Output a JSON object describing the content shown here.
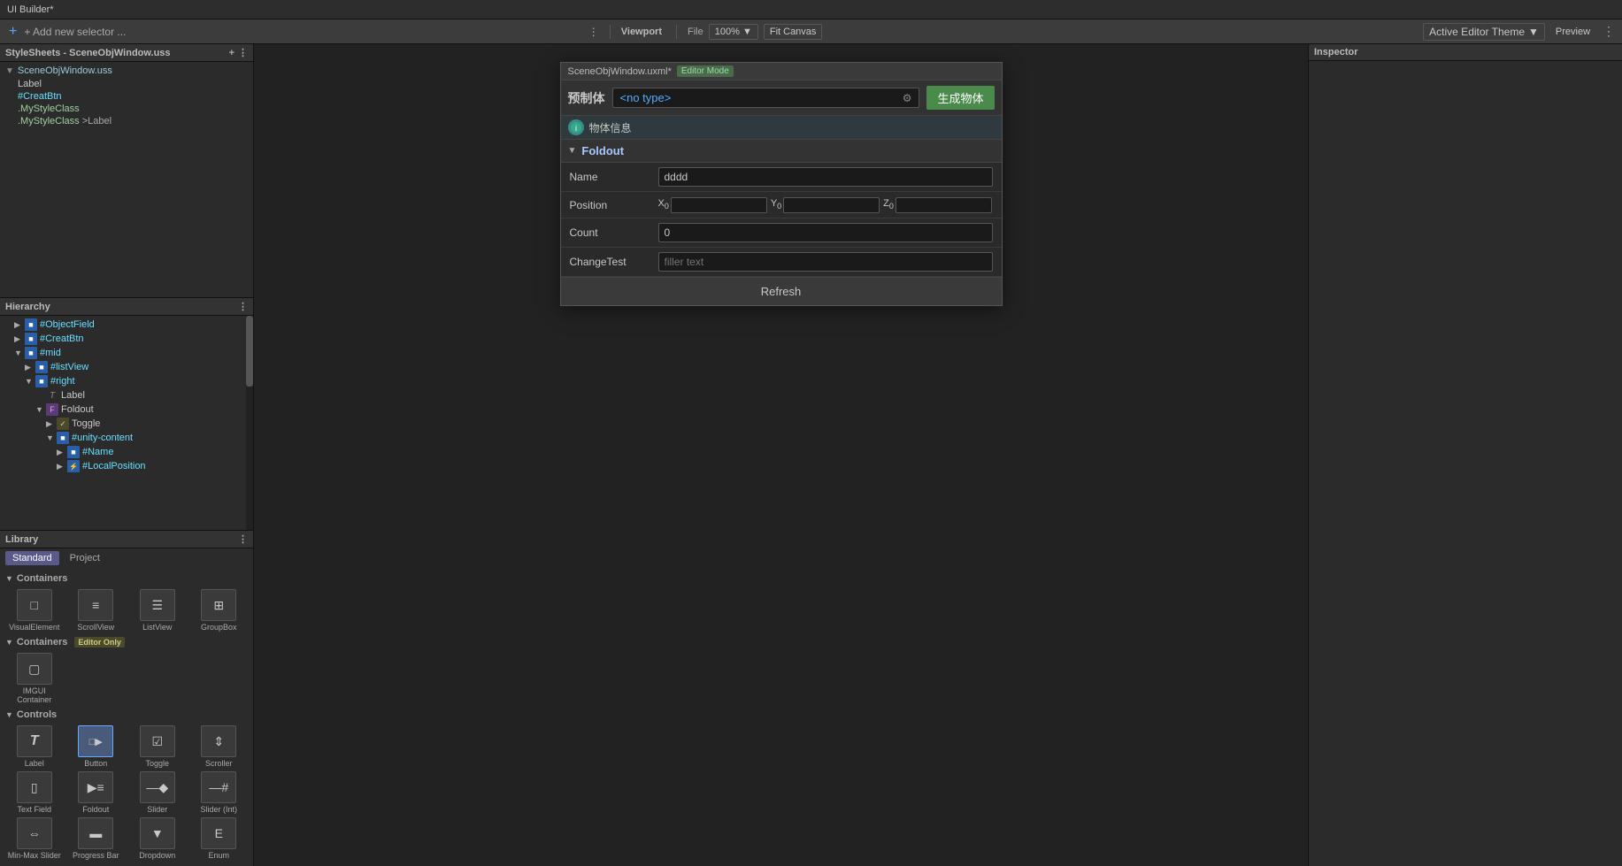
{
  "app": {
    "title": "UI Builder*"
  },
  "toolbar": {
    "add_selector_label": "+ Add new selector ...",
    "zoom_label": "100%",
    "zoom_arrow": "▼",
    "fit_canvas_label": "Fit Canvas",
    "theme_label": "Active Editor Theme",
    "theme_arrow": "▼",
    "preview_label": "Preview",
    "dots_label": "⋮"
  },
  "stylesheets_panel": {
    "title": "StyleSheets - SceneObjWindow.uss",
    "dots": "⋮",
    "plus": "+",
    "file_label": "SceneObjWindow.uss",
    "items": [
      {
        "text": "Label",
        "type": "plain"
      },
      {
        "text": "#CreatBtn",
        "type": "hash"
      },
      {
        "text": ".MyStyleClass",
        "type": "dot"
      },
      {
        "text": ".MyStyleClass  >Label",
        "type": "dot-child"
      }
    ]
  },
  "hierarchy_panel": {
    "title": "Hierarchy",
    "dots": "⋮",
    "items": [
      {
        "indent": 1,
        "arrow": "▶",
        "icon": "blue",
        "name": "#ObjectField"
      },
      {
        "indent": 1,
        "arrow": "▶",
        "icon": "blue",
        "name": "#CreatBtn"
      },
      {
        "indent": 1,
        "arrow": "▼",
        "icon": "blue",
        "name": "#mid"
      },
      {
        "indent": 2,
        "arrow": "▶",
        "icon": "blue",
        "name": "#listView"
      },
      {
        "indent": 2,
        "arrow": "▼",
        "icon": "blue",
        "name": "#right"
      },
      {
        "indent": 3,
        "arrow": " ",
        "icon": "t",
        "name": "Label"
      },
      {
        "indent": 3,
        "arrow": "▼",
        "icon": "foldout",
        "name": "Foldout"
      },
      {
        "indent": 4,
        "arrow": "▶",
        "icon": "toggle",
        "name": "Toggle"
      },
      {
        "indent": 4,
        "arrow": "▼",
        "icon": "blue",
        "name": "#unity-content"
      },
      {
        "indent": 5,
        "arrow": "▶",
        "icon": "blue",
        "name": "#Name"
      },
      {
        "indent": 5,
        "arrow": "▶",
        "icon": "blue",
        "name": "#LocalPosition"
      }
    ]
  },
  "library_panel": {
    "title": "Library",
    "dots": "⋮",
    "tabs": [
      {
        "label": "Standard",
        "active": true
      },
      {
        "label": "Project",
        "active": false
      }
    ],
    "sections": [
      {
        "name": "Containers",
        "items": [
          {
            "label": "VisualElement",
            "icon": "□"
          },
          {
            "label": "ScrollView",
            "icon": "≡"
          },
          {
            "label": "ListView",
            "icon": "☰"
          },
          {
            "label": "GroupBox",
            "icon": "⊞"
          }
        ]
      },
      {
        "name": "Containers (Editor Only)",
        "items": [
          {
            "label": "IMGUI Container",
            "icon": "▢"
          }
        ]
      },
      {
        "name": "Controls",
        "items": [
          {
            "label": "Label",
            "icon": "T"
          },
          {
            "label": "Button",
            "icon": "□",
            "selected": true
          },
          {
            "label": "Toggle",
            "icon": "☑"
          },
          {
            "label": "Scroller",
            "icon": "⇕"
          },
          {
            "label": "Text Field",
            "icon": "▯"
          },
          {
            "label": "Foldout",
            "icon": "▶"
          },
          {
            "label": "Slider",
            "icon": "—"
          },
          {
            "label": "Slider (Int)",
            "icon": "—"
          },
          {
            "label": "Min-Max Slider",
            "icon": "⇔"
          },
          {
            "label": "Progress Bar",
            "icon": "▬"
          },
          {
            "label": "Dropdown",
            "icon": "▼"
          },
          {
            "label": "Enum",
            "icon": "E"
          }
        ]
      }
    ]
  },
  "viewport": {
    "tab_label": "Viewport",
    "scene_file": "SceneObjWindow.uxml*",
    "editor_mode_badge": "Editor Mode",
    "prefab_label": "预制体",
    "type_placeholder": "<no type>",
    "generate_btn": "生成物体",
    "info_text": "物体信息",
    "foldout_label": "Foldout",
    "foldout_arrow": "▼",
    "name_label": "Name",
    "name_value": "dddd",
    "position_label": "Position",
    "pos_x_label": "X",
    "pos_x_sub": "0",
    "pos_y_label": "Y",
    "pos_y_sub": "0",
    "pos_z_label": "Z",
    "pos_z_sub": "0",
    "pos_x_value": "",
    "pos_y_value": "",
    "pos_z_value": "",
    "count_label": "Count",
    "count_value": "0",
    "change_test_label": "ChangeTest",
    "change_test_placeholder": "filler text",
    "refresh_label": "Refresh"
  },
  "inspector_panel": {
    "title": "Inspector"
  }
}
